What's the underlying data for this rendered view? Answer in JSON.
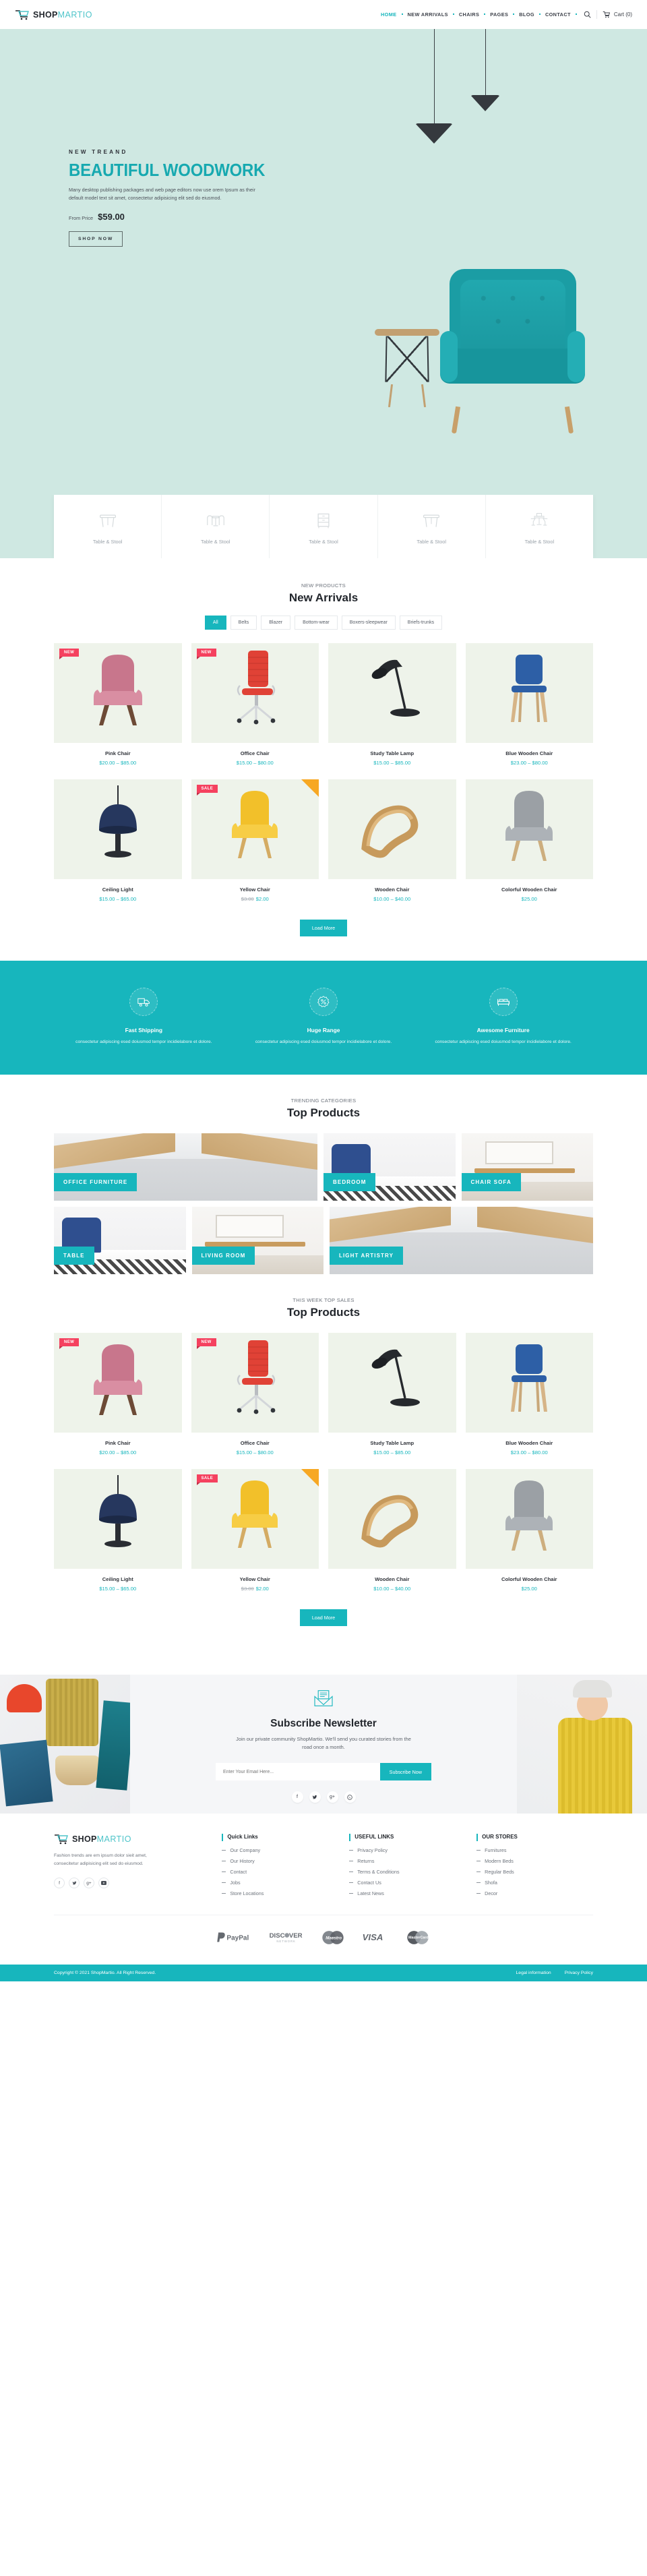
{
  "header": {
    "brand": {
      "part1": "SHOP",
      "part2": "MARTIO",
      "icon": "cart-logo-icon"
    },
    "nav": [
      {
        "label": "HOME",
        "active": true
      },
      {
        "label": "NEW ARRIVALS",
        "active": false
      },
      {
        "label": "CHAIRS",
        "active": false
      },
      {
        "label": "PAGES",
        "active": false
      },
      {
        "label": "BLOG",
        "active": false
      },
      {
        "label": "CONTACT",
        "active": false
      }
    ],
    "search_icon": "search-icon",
    "cart_icon": "cart-icon",
    "cart_label": "Cart (0)"
  },
  "hero": {
    "eyebrow": "NEW TREAND",
    "title": "BEAUTIFUL WOODWORK",
    "desc": "Many desktop publishing packages and web page editors now use orem Ipsum as their default model text sit amet, consectetur adipisicing elit sed do eiusmod.",
    "price_label": "From Price",
    "price_value": "$59.00",
    "cta": "SHOP NOW"
  },
  "categories": [
    {
      "label": "Table & Stool",
      "icon": "table-icon"
    },
    {
      "label": "Table & Stool",
      "icon": "dining-set-icon"
    },
    {
      "label": "Table & Stool",
      "icon": "dresser-icon"
    },
    {
      "label": "Table & Stool",
      "icon": "desk-icon"
    },
    {
      "label": "Table & Stool",
      "icon": "bar-table-icon"
    }
  ],
  "new_arrivals": {
    "eyebrow": "NEW PRODUCTS",
    "title": "New Arrivals",
    "tabs": [
      {
        "label": "All",
        "active": true
      },
      {
        "label": "Belts",
        "active": false
      },
      {
        "label": "Blazer",
        "active": false
      },
      {
        "label": "Bottom-wear",
        "active": false
      },
      {
        "label": "Boxers-sleepwear",
        "active": false
      },
      {
        "label": "Briefs-trunks",
        "active": false
      }
    ],
    "products": [
      {
        "name": "Pink Chair",
        "price": "$20.00 – $85.00",
        "badge": "NEW",
        "ribbon": false,
        "art": "pink-chair"
      },
      {
        "name": "Office Chair",
        "price": "$15.00 – $80.00",
        "badge": "NEW",
        "ribbon": false,
        "art": "office-chair"
      },
      {
        "name": "Study Table Lamp",
        "price": "$15.00 – $85.00",
        "badge": "",
        "ribbon": false,
        "art": "desk-lamp"
      },
      {
        "name": "Blue Wooden Chair",
        "price": "$23.00 – $80.00",
        "badge": "",
        "ribbon": false,
        "art": "blue-chair"
      },
      {
        "name": "Ceiling Light",
        "price": "$15.00 – $65.00",
        "badge": "",
        "ribbon": false,
        "art": "ceiling-light"
      },
      {
        "name": "Yellow Chair",
        "price": "$2.00",
        "old_price": "$3.00",
        "badge": "SALE",
        "ribbon": true,
        "art": "yellow-chair"
      },
      {
        "name": "Wooden Chair",
        "price": "$10.00 – $40.00",
        "badge": "",
        "ribbon": false,
        "art": "wooden-chair"
      },
      {
        "name": "Colorful Wooden Chair",
        "price": "$25.00",
        "badge": "",
        "ribbon": false,
        "art": "grey-chair"
      }
    ],
    "load_more": "Load More"
  },
  "features": [
    {
      "title": "Fast Shipping",
      "desc": "consectetur adipiscing esed doiusmod tempor incidielabore et dolore.",
      "icon": "truck-icon"
    },
    {
      "title": "Huge Range",
      "desc": "consectetur adipiscing esed doiusmod tempor incidielabore et dolore.",
      "icon": "discount-badge-icon"
    },
    {
      "title": "Awesome Furniture",
      "desc": "consectetur adipiscing esed doiusmod tempor incidielabore et dolore.",
      "icon": "bed-icon"
    }
  ],
  "trending": {
    "eyebrow": "Trending Categories",
    "title": "Top Products",
    "row1": [
      {
        "label": "OFFICE FURNITURE",
        "art": "office"
      },
      {
        "label": "BEDROOM",
        "art": "bed"
      },
      {
        "label": "CHAIR SOFA",
        "art": "desk"
      }
    ],
    "row2": [
      {
        "label": "TABLE",
        "art": "bed"
      },
      {
        "label": "LIVING ROOM",
        "art": "desk"
      },
      {
        "label": "LIGHT ARTISTRY",
        "art": "office"
      }
    ]
  },
  "top_sales": {
    "eyebrow": "This Week Top Sales",
    "title": "Top Products",
    "products": [
      {
        "name": "Pink Chair",
        "price": "$20.00 – $85.00",
        "badge": "NEW",
        "ribbon": false,
        "art": "pink-chair"
      },
      {
        "name": "Office Chair",
        "price": "$15.00 – $80.00",
        "badge": "NEW",
        "ribbon": false,
        "art": "office-chair"
      },
      {
        "name": "Study Table Lamp",
        "price": "$15.00 – $85.00",
        "badge": "",
        "ribbon": false,
        "art": "desk-lamp"
      },
      {
        "name": "Blue Wooden Chair",
        "price": "$23.00 – $80.00",
        "badge": "",
        "ribbon": false,
        "art": "blue-chair"
      },
      {
        "name": "Ceiling Light",
        "price": "$15.00 – $65.00",
        "badge": "",
        "ribbon": false,
        "art": "ceiling-light"
      },
      {
        "name": "Yellow Chair",
        "price": "$2.00",
        "old_price": "$3.00",
        "badge": "SALE",
        "ribbon": true,
        "art": "yellow-chair"
      },
      {
        "name": "Wooden Chair",
        "price": "$10.00 – $40.00",
        "badge": "",
        "ribbon": false,
        "art": "wooden-chair"
      },
      {
        "name": "Colorful Wooden Chair",
        "price": "$25.00",
        "badge": "",
        "ribbon": false,
        "art": "grey-chair"
      }
    ],
    "load_more": "Load More"
  },
  "newsletter": {
    "icon": "envelope-icon",
    "title": "Subscribe Newsletter",
    "subtitle": "Join our private community ShopMartio. We'll send you curated stories from the road once a month.",
    "placeholder": "Enter Your Email Here...",
    "button": "Subscribe Now",
    "socials": [
      "facebook-icon",
      "twitter-icon",
      "google-plus-icon",
      "whatsapp-icon"
    ]
  },
  "footer": {
    "brand": {
      "part1": "SHOP",
      "part2": "MARTIO"
    },
    "about": "Fashion trends are em ipsum dolor sieit amet, consecitetur adipisicing elit sed do eiusmod.",
    "socials": [
      "facebook-icon",
      "twitter-icon",
      "google-plus-icon",
      "youtube-icon"
    ],
    "columns": [
      {
        "heading": "Quick Links",
        "links": [
          "Our Company",
          "Our History",
          "Contact",
          "Jobs",
          "Store Locations"
        ]
      },
      {
        "heading": "USEFUL LINKS",
        "links": [
          "Privacy Policy",
          "Returns",
          "Terms & Conditions",
          "Contact Us",
          "Latest News"
        ]
      },
      {
        "heading": "OUR STORES",
        "links": [
          "Furnitures",
          "Modern Beds",
          "Regular Beds",
          "Shofa",
          "Decor"
        ]
      }
    ],
    "payments": [
      "PayPal",
      "DISCOVER NETWORK",
      "Maestro",
      "VISA",
      "MasterCard"
    ],
    "copyright": "Copyright © 2021 ShopMartio. All Right Reserved.",
    "bottom_links": [
      "Legal information",
      "Privacy Policy"
    ]
  },
  "colors": {
    "accent": "#17b6bd",
    "hero_bg": "#cfe8e2",
    "badge_new": "#f5415f",
    "ribbon": "#f7a823",
    "product_bg": "#eef3ea"
  }
}
